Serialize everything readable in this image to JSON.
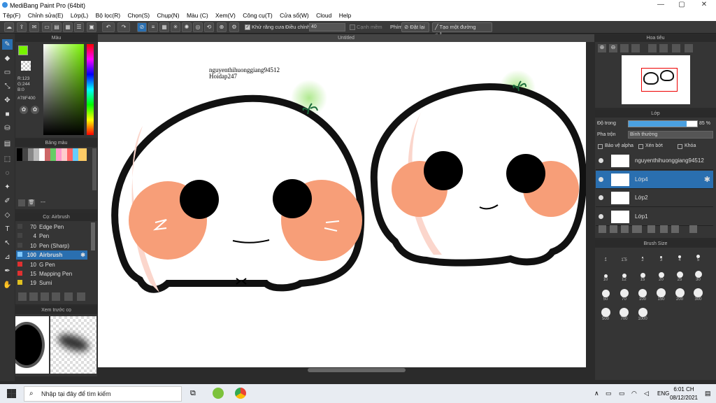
{
  "window": {
    "title": "MediBang Paint Pro (64bit)",
    "min": "—",
    "max": "▢",
    "close": "✕"
  },
  "menu": [
    "Tệp(F)",
    "Chỉnh sửa(E)",
    "Lớp(L)",
    "Bộ lọc(R)",
    "Chọn(S)",
    "Chụp(N)",
    "Màu (C)",
    "Xem(V)",
    "Công cụ(T)",
    "Cửa sổ(W)",
    "Cloud",
    "Help"
  ],
  "toolbar": {
    "antialias_label": "Khử răng cưa",
    "adjust_label": "Điều chỉnh",
    "adjust_value": "40",
    "edge_label": "Cạnh mềm",
    "shortcut_label": "Phím",
    "reset_label": "Đặt lại",
    "line_label": "Tạo một đường thẳng"
  },
  "canvas": {
    "tab_title": "Untitled",
    "watermark_line1": "nguyenthihuonggiang94512",
    "watermark_line2": "Hoidap247"
  },
  "color_panel": {
    "title": "Màu",
    "r": "R:123",
    "g": "G:244",
    "b": "B:0",
    "hex": "#78F400",
    "fg_color": "#78f400"
  },
  "palette_panel": {
    "title": "Bảng màu",
    "name": "---"
  },
  "brush_panel": {
    "title": "Cọ: Airbrush",
    "items": [
      {
        "size": "70",
        "name": "Edge Pen",
        "color": "#444"
      },
      {
        "size": "4",
        "name": "Pen",
        "color": "#444"
      },
      {
        "size": "10",
        "name": "Pen (Sharp)",
        "color": "#444"
      },
      {
        "size": "100",
        "name": "Airbrush",
        "color": "#7ec8ff"
      },
      {
        "size": "10",
        "name": "G Pen",
        "color": "#e03030"
      },
      {
        "size": "15",
        "name": "Mapping Pen",
        "color": "#e03030"
      },
      {
        "size": "19",
        "name": "Sumi",
        "color": "#e0c020"
      }
    ]
  },
  "preview_panel": {
    "title": "Xem trước cọ"
  },
  "nav_panel": {
    "title": "Hoa tiêu"
  },
  "layer_panel": {
    "title": "Lớp",
    "opacity_label": "Độ trong",
    "opacity_value": "85 %",
    "opacity": 0.85,
    "blend_label": "Pha trộn",
    "blend_value": "Bình thường",
    "protect_alpha": "Bảo vệ alpha",
    "clipping": "Xén bớt",
    "lock": "Khóa",
    "layers": [
      {
        "name": "nguyenthihuonggiang94512",
        "selected": false
      },
      {
        "name": "Lớp4",
        "selected": true
      },
      {
        "name": "Lớp2",
        "selected": false
      },
      {
        "name": "Lớp1",
        "selected": false
      }
    ]
  },
  "brush_size_panel": {
    "title": "Brush Size",
    "sizes": [
      "1",
      "1.5",
      "2",
      "3",
      "4",
      "5",
      "10",
      "12",
      "15",
      "20",
      "25",
      "30",
      "50",
      "70",
      "100",
      "150",
      "200",
      "300",
      "500",
      "700",
      "1000"
    ]
  },
  "taskbar": {
    "search_placeholder": "Nhập tại đây để tìm kiếm",
    "lang": "ENG",
    "time": "6:01 CH",
    "date": "08/12/2021"
  }
}
